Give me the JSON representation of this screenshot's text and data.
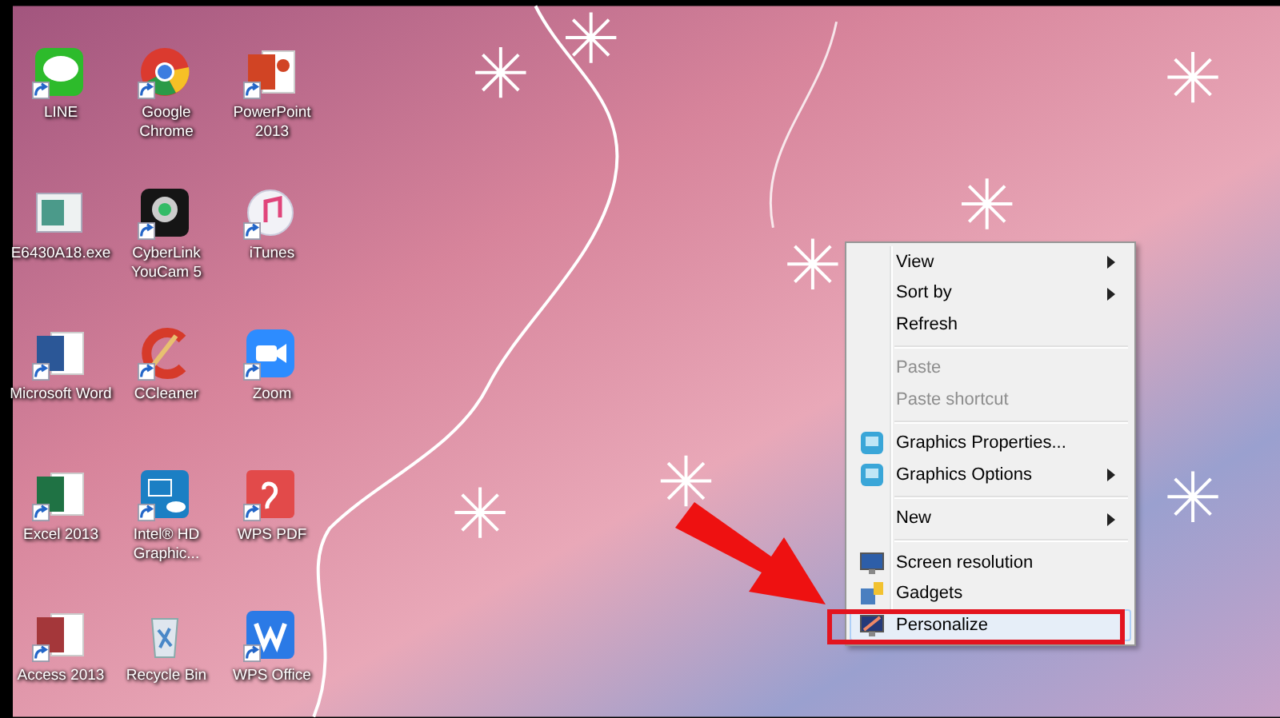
{
  "desktop_icons": [
    {
      "label": "LINE",
      "kind": "line",
      "shortcut": true
    },
    {
      "label": "Google Chrome",
      "kind": "chrome",
      "shortcut": true
    },
    {
      "label": "PowerPoint 2013",
      "kind": "powerpoint",
      "shortcut": true
    },
    {
      "label": "E6430A18.exe",
      "kind": "exe",
      "shortcut": false
    },
    {
      "label": "CyberLink YouCam 5",
      "kind": "webcam",
      "shortcut": true
    },
    {
      "label": "iTunes",
      "kind": "music",
      "shortcut": true
    },
    {
      "label": "Microsoft Word",
      "kind": "word",
      "shortcut": true
    },
    {
      "label": "CCleaner",
      "kind": "cleaner",
      "shortcut": true
    },
    {
      "label": "Zoom",
      "kind": "video",
      "shortcut": true
    },
    {
      "label": "Excel 2013",
      "kind": "excel",
      "shortcut": true
    },
    {
      "label": "Intel® HD Graphic...",
      "kind": "intel",
      "shortcut": true
    },
    {
      "label": "WPS PDF",
      "kind": "pdf",
      "shortcut": true
    },
    {
      "label": "Access 2013",
      "kind": "access",
      "shortcut": true
    },
    {
      "label": "Recycle Bin",
      "kind": "recycle",
      "shortcut": false
    },
    {
      "label": "WPS Office",
      "kind": "office",
      "shortcut": true
    }
  ],
  "context_menu": {
    "items": [
      {
        "kind": "item",
        "label": "View",
        "disabled": false,
        "submenu": true,
        "selected": false
      },
      {
        "kind": "item",
        "label": "Sort by",
        "disabled": false,
        "submenu": true,
        "selected": false
      },
      {
        "kind": "item",
        "label": "Refresh",
        "disabled": false,
        "submenu": false,
        "selected": false
      },
      {
        "kind": "separator"
      },
      {
        "kind": "item",
        "label": "Paste",
        "disabled": true,
        "submenu": false,
        "selected": false
      },
      {
        "kind": "item",
        "label": "Paste shortcut",
        "disabled": true,
        "submenu": false,
        "selected": false
      },
      {
        "kind": "separator"
      },
      {
        "kind": "item",
        "label": "Graphics Properties...",
        "disabled": false,
        "submenu": false,
        "selected": false
      },
      {
        "kind": "item",
        "label": "Graphics Options",
        "disabled": false,
        "submenu": true,
        "selected": false
      },
      {
        "kind": "separator"
      },
      {
        "kind": "item",
        "label": "New",
        "disabled": false,
        "submenu": true,
        "selected": false
      },
      {
        "kind": "separator"
      },
      {
        "kind": "item",
        "label": "Screen resolution",
        "disabled": false,
        "submenu": false,
        "selected": false
      },
      {
        "kind": "item",
        "label": "Gadgets",
        "disabled": false,
        "submenu": false,
        "selected": false
      },
      {
        "kind": "item",
        "label": "Personalize",
        "disabled": false,
        "submenu": false,
        "selected": true
      }
    ]
  }
}
